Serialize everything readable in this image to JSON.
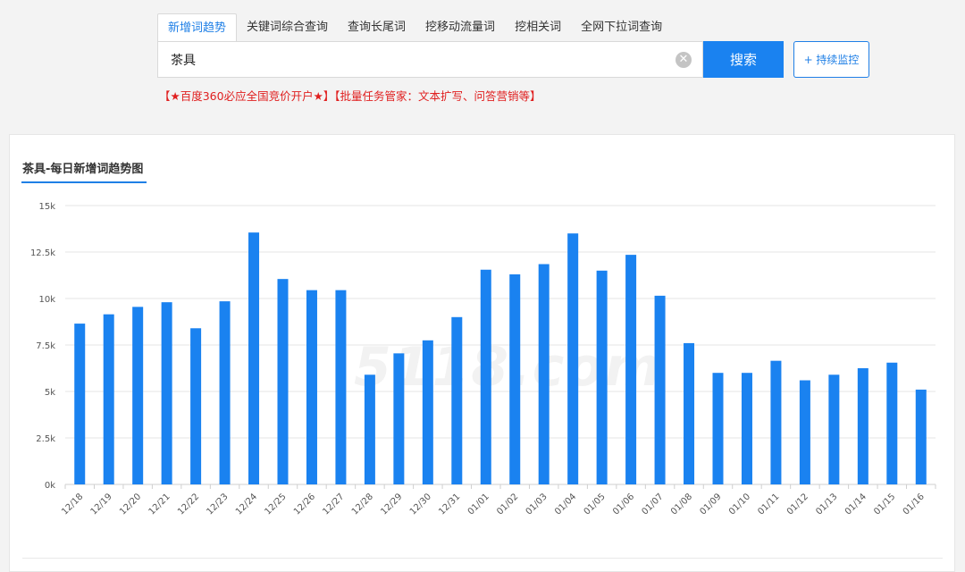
{
  "tabs": [
    {
      "label": "新增词趋势",
      "active": true
    },
    {
      "label": "关键词综合查询",
      "active": false
    },
    {
      "label": "查询长尾词",
      "active": false
    },
    {
      "label": "挖移动流量词",
      "active": false
    },
    {
      "label": "挖相关词",
      "active": false
    },
    {
      "label": "全网下拉词查询",
      "active": false
    }
  ],
  "search": {
    "value": "茶具",
    "button_label": "搜索",
    "monitor_label": "+ 持续监控"
  },
  "promo": {
    "link1": "【★百度360必应全国竞价开户★】",
    "link2": "【批量任务管家：文本扩写、问答营销等】"
  },
  "watermark": "5118.com",
  "colors": {
    "accent": "#1f7fe6",
    "bar": "#1a82f0",
    "promo": "#e02020"
  },
  "chart_data": {
    "type": "bar",
    "title": "茶具-每日新增词趋势图",
    "categories": [
      "12/18",
      "12/19",
      "12/20",
      "12/21",
      "12/22",
      "12/23",
      "12/24",
      "12/25",
      "12/26",
      "12/27",
      "12/28",
      "12/29",
      "12/30",
      "12/31",
      "01/01",
      "01/02",
      "01/03",
      "01/04",
      "01/05",
      "01/06",
      "01/07",
      "01/08",
      "01/09",
      "01/10",
      "01/11",
      "01/12",
      "01/13",
      "01/14",
      "01/15",
      "01/16"
    ],
    "values": [
      8650,
      9150,
      9550,
      9800,
      8400,
      9850,
      13550,
      11050,
      10450,
      10450,
      5900,
      7050,
      7750,
      9000,
      11550,
      11300,
      11850,
      13500,
      11500,
      12350,
      10150,
      7600,
      6000,
      6000,
      6650,
      5600,
      5900,
      6250,
      6550,
      5100
    ],
    "yticks": [
      0,
      2500,
      5000,
      7500,
      10000,
      12500,
      15000
    ],
    "ytick_labels": [
      "0k",
      "2.5k",
      "5k",
      "7.5k",
      "10k",
      "12.5k",
      "15k"
    ],
    "ylim": [
      0,
      15000
    ],
    "grid": true,
    "legend": "none"
  }
}
